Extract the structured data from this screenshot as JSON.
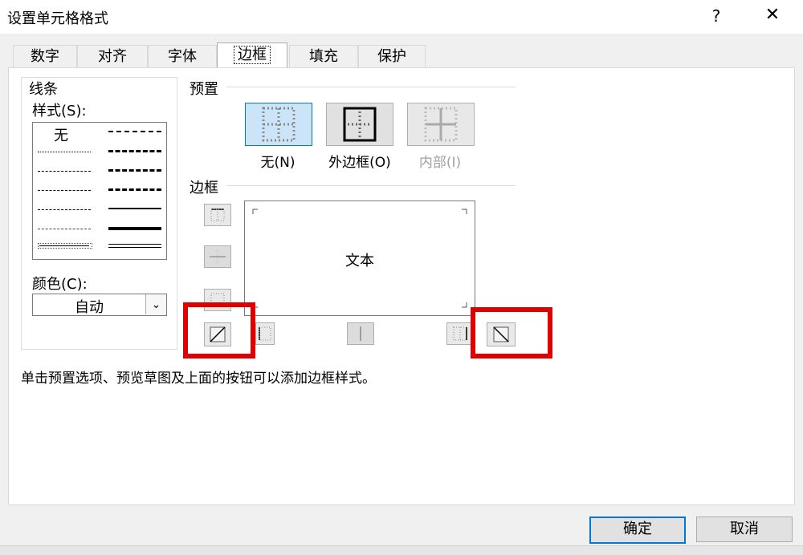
{
  "dialog": {
    "title": "设置单元格格式",
    "help_label": "?",
    "close_label": "✕"
  },
  "tabs": [
    {
      "label": "数字"
    },
    {
      "label": "对齐"
    },
    {
      "label": "字体"
    },
    {
      "label": "边框",
      "active": true
    },
    {
      "label": "填充"
    },
    {
      "label": "保护"
    }
  ],
  "line_group": {
    "title": "线条",
    "style_label": "样式(S):",
    "none_label": "无",
    "color_label": "颜色(C):",
    "color_value": "自动"
  },
  "presets": {
    "title": "预置",
    "items": [
      {
        "label": "无(N)",
        "icon": "preset-none-icon",
        "selected": true
      },
      {
        "label": "外边框(O)",
        "icon": "preset-outline-icon"
      },
      {
        "label": "内部(I)",
        "icon": "preset-inside-icon",
        "disabled": true
      }
    ]
  },
  "border": {
    "title": "边框",
    "preview_text": "文本",
    "buttons": [
      "border-top-icon",
      "border-middle-horizontal-icon",
      "border-bottom-icon",
      "diagonal-up-icon",
      "border-left-icon",
      "border-middle-vertical-icon",
      "border-right-icon",
      "diagonal-down-icon"
    ]
  },
  "hint": "单击预置选项、预览草图及上面的按钮可以添加边框样式。",
  "footer": {
    "ok_label": "确定",
    "cancel_label": "取消"
  },
  "colors": {
    "highlight": "#e00000",
    "accent": "#0078d7",
    "dialog_bg": "#f0f0f0"
  }
}
